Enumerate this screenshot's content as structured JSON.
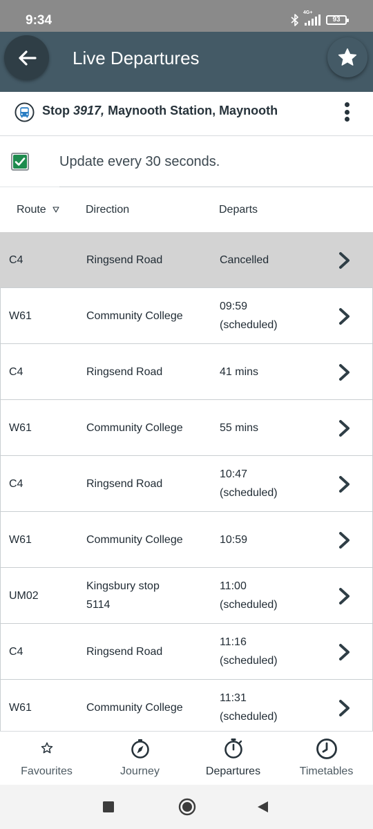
{
  "status": {
    "time": "9:34",
    "network": "4G+",
    "battery": "93"
  },
  "header": {
    "title": "Live Departures"
  },
  "stop": {
    "prefix": "Stop",
    "number": "3917,",
    "name": "Maynooth Station, Maynooth"
  },
  "update": {
    "label": "Update every 30 seconds.",
    "checked": true
  },
  "table": {
    "columns": {
      "route": "Route",
      "direction": "Direction",
      "departs": "Departs"
    },
    "rows": [
      {
        "route": "C4",
        "direction": "Ringsend Road",
        "direction2": "",
        "departs": "Cancelled",
        "departs2": ""
      },
      {
        "route": "W61",
        "direction": "Community College",
        "direction2": "",
        "departs": "09:59",
        "departs2": "(scheduled)"
      },
      {
        "route": "C4",
        "direction": "Ringsend Road",
        "direction2": "",
        "departs": "41 mins",
        "departs2": ""
      },
      {
        "route": "W61",
        "direction": "Community College",
        "direction2": "",
        "departs": "55 mins",
        "departs2": ""
      },
      {
        "route": "C4",
        "direction": "Ringsend Road",
        "direction2": "",
        "departs": "10:47",
        "departs2": "(scheduled)"
      },
      {
        "route": "W61",
        "direction": "Community College",
        "direction2": "",
        "departs": "10:59",
        "departs2": ""
      },
      {
        "route": "UM02",
        "direction": "Kingsbury stop",
        "direction2": "5114",
        "departs": "11:00",
        "departs2": "(scheduled)"
      },
      {
        "route": "C4",
        "direction": "Ringsend Road",
        "direction2": "",
        "departs": "11:16",
        "departs2": "(scheduled)"
      },
      {
        "route": "W61",
        "direction": "Community College",
        "direction2": "",
        "departs": "11:31",
        "departs2": "(scheduled)"
      }
    ]
  },
  "nav": {
    "items": [
      {
        "label": "Favourites",
        "icon": "star-outline-icon"
      },
      {
        "label": "Journey",
        "icon": "compass-icon"
      },
      {
        "label": "Departures",
        "icon": "stopwatch-icon"
      },
      {
        "label": "Timetables",
        "icon": "clock-icon"
      }
    ],
    "active": "Departures"
  },
  "colors": {
    "app_bar": "#445a66",
    "back_button": "#2f3e46",
    "checkbox": "#1e8b4e",
    "highlight_row": "#d3d3d3",
    "status_bar": "#8a8a8a"
  }
}
